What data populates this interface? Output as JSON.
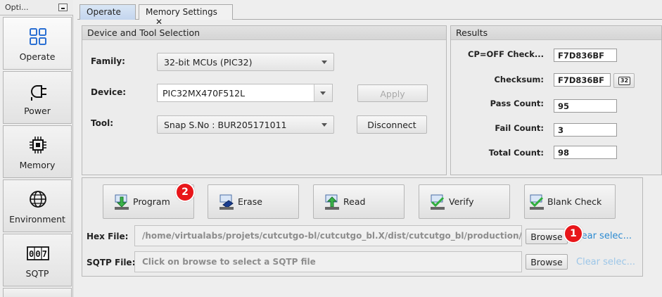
{
  "options_panel": {
    "title": "Opti...",
    "items": [
      {
        "label": "Operate",
        "icon": "grid-icon"
      },
      {
        "label": "Power",
        "icon": "power-plug-icon"
      },
      {
        "label": "Memory",
        "icon": "memory-chip-icon"
      },
      {
        "label": "Environment",
        "icon": "globe-icon"
      },
      {
        "label": "SQTP",
        "icon": "counter-icon",
        "icon_text": "007"
      }
    ]
  },
  "tabs": [
    {
      "label": "Operate",
      "selected": true
    },
    {
      "label": "Memory Settings",
      "close": "✕"
    }
  ],
  "device_tool": {
    "title": "Device and Tool Selection",
    "family_label": "Family:",
    "family_value": "32-bit MCUs (PIC32)",
    "device_label": "Device:",
    "device_value": "PIC32MX470F512L",
    "apply_label": "Apply",
    "tool_label": "Tool:",
    "tool_value": "Snap S.No : BUR205171011",
    "disconnect_label": "Disconnect"
  },
  "results": {
    "title": "Results",
    "rows": [
      {
        "label": "CP=OFF Check...",
        "value": "F7D836BF"
      },
      {
        "label": "Checksum:",
        "value": "F7D836BF"
      },
      {
        "label": "Pass Count:",
        "value": "95"
      },
      {
        "label": "Fail Count:",
        "value": "3"
      },
      {
        "label": "Total Count:",
        "value": "98"
      }
    ],
    "badge_text": "32"
  },
  "actions": {
    "buttons": [
      {
        "label": "Program",
        "icon": "program-arrow-icon"
      },
      {
        "label": "Erase",
        "icon": "erase-icon"
      },
      {
        "label": "Read",
        "icon": "read-arrow-icon"
      },
      {
        "label": "Verify",
        "icon": "verify-check-icon"
      },
      {
        "label": "Blank Check",
        "icon": "blank-check-icon"
      }
    ],
    "hex_label": "Hex File:",
    "hex_value": "/home/virtualabs/projets/cutcutgo-bl/cutcutgo_bl.X/dist/cutcutgo_bl/production/cutc...",
    "sqtp_label": "SQTP File:",
    "sqtp_placeholder": "Click on browse to select a SQTP file",
    "browse_label": "Browse",
    "clear_label": "Clear selec...",
    "clear_label_partial": "lear selec..."
  },
  "markers": [
    "1",
    "2"
  ],
  "colors": {
    "link": "#2b8ad1",
    "link_disabled": "#9cc6e8",
    "marker": "#e8161a",
    "tab_selected": "#c9dbf1"
  }
}
